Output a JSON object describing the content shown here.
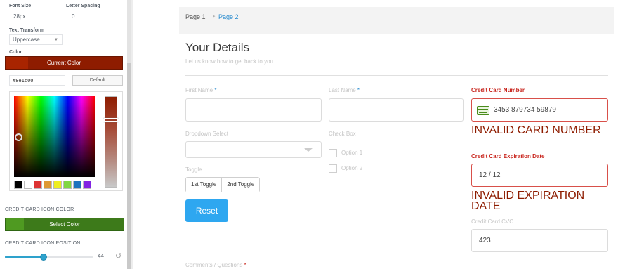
{
  "panel": {
    "font_size_label": "Font Size",
    "letter_spacing_label": "Letter Spacing",
    "font_size_value": "28px",
    "letter_spacing_value": "0",
    "text_transform_label": "Text Transform",
    "text_transform_value": "Uppercase",
    "color_label": "Color",
    "current_color_label": "Current Color",
    "current_color": "#8e1c00",
    "hex_value": "#8e1c00",
    "default_label": "Default",
    "swatches": [
      "#000000",
      "#ffffff",
      "#dd3333",
      "#dd9933",
      "#eeee22",
      "#81d742",
      "#1e73be",
      "#8224e3"
    ],
    "icon_color_section": "CREDIT CARD ICON COLOR",
    "select_color_label": "Select Color",
    "icon_color": "#3d7a1a",
    "icon_position_section": "CREDIT CARD ICON POSITION",
    "icon_position_value": "44",
    "icon_position_max": 100
  },
  "form": {
    "breadcrumb": {
      "page1": "Page 1",
      "separator": "▸",
      "page2": "Page 2"
    },
    "title": "Your Details",
    "subtitle": "Let us know how to get back to you.",
    "first_name_label": "First Name",
    "last_name_label": "Last Name",
    "required_mark": "*",
    "cc_number_label": "Credit Card Number",
    "cc_number_value": "3453 879734 59879",
    "cc_number_error": "INVALID CARD NUMBER",
    "dropdown_label": "Dropdown Select",
    "checkbox_label": "Check Box",
    "options": [
      "Option 1",
      "Option 2"
    ],
    "cc_exp_label": "Credit Card Expiration Date",
    "cc_exp_value": "12 / 12",
    "cc_exp_error": "INVALID EXPIRATION DATE",
    "toggle_label": "Toggle",
    "toggles": [
      "1st Toggle",
      "2nd Toggle"
    ],
    "reset_label": "Reset",
    "cc_cvc_label": "Credit Card CVC",
    "cc_cvc_value": "423",
    "comments_label": "Comments / Questions",
    "accent": "#2ea7f0",
    "error_color": "#c8241c"
  }
}
